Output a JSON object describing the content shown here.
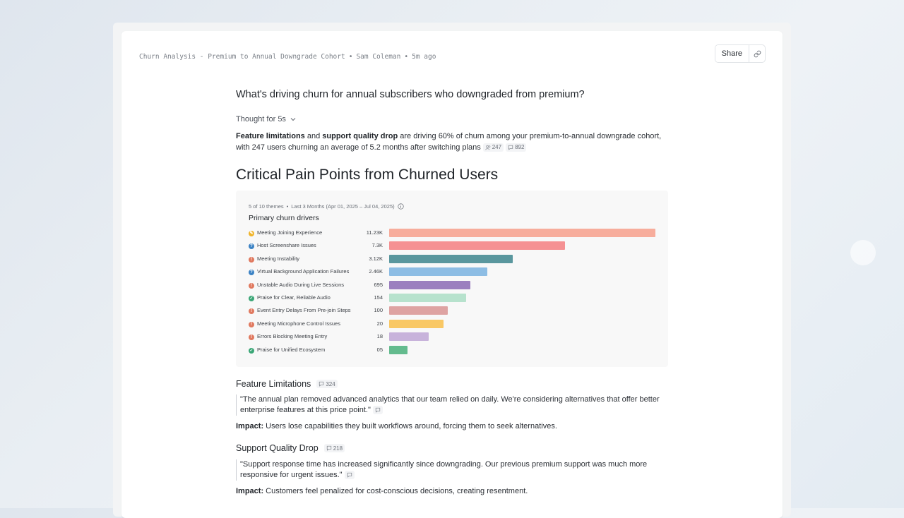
{
  "header": {
    "breadcrumb_title": "Churn Analysis - Premium to Annual Downgrade Cohort",
    "author": "Sam Coleman",
    "time": "5m ago",
    "share_label": "Share",
    "separator": "•"
  },
  "question": "What's driving churn for annual subscribers who downgraded from premium?",
  "thought_label": "Thought for 5s",
  "summary": {
    "b1": "Feature limitations",
    "t1": " and ",
    "b2": "support quality drop",
    "t2": " are driving 60% of churn among your premium-to-annual downgrade cohort, with 247 users churning an average of 5.2 months after switching plans",
    "users_count": "247",
    "comments_count": "892"
  },
  "section_title": "Critical Pain Points from Churned Users",
  "chart_data": {
    "type": "bar",
    "meta": "5 of 10 themes",
    "range": "Last 3 Months (Apr 01, 2025 – Jul 04, 2025)",
    "title": "Primary churn drivers",
    "categories": [
      "Meeting Joining Experience",
      "Host Screenshare Issues",
      "Meeting Instability",
      "Virtual Background Application Failures",
      "Unstable Audio During Live Sessions",
      "Praise for Clear, Reliable Audio",
      "Event Entry Delays From Pre-join Steps",
      "Meeting Microphone Control Issues",
      "Errors Blocking Meeting Entry",
      "Praise for Unified Ecosystem"
    ],
    "value_labels": [
      "11.23K",
      "7.3K",
      "3.12K",
      "2.46K",
      "695",
      "154",
      "100",
      "20",
      "18",
      "05"
    ],
    "relative_lengths": [
      1.0,
      0.66,
      0.465,
      0.368,
      0.305,
      0.288,
      0.22,
      0.205,
      0.148,
      0.068
    ],
    "status": [
      "warning",
      "question",
      "negative",
      "question",
      "negative",
      "positive",
      "negative",
      "negative",
      "negative",
      "positive"
    ],
    "colors": [
      "#f7ad9c",
      "#f59193",
      "#5a979e",
      "#8dbde4",
      "#9b7fbf",
      "#b7e2cd",
      "#dea3a2",
      "#f9c865",
      "#c8b3db",
      "#64bb8e"
    ],
    "status_colors": {
      "warning": "#f0b429",
      "question": "#3b82c4",
      "negative": "#e0785e",
      "positive": "#3aa676"
    }
  },
  "themes": [
    {
      "title": "Feature Limitations",
      "count": "324",
      "quote": "\"The annual plan removed advanced analytics that our team relied on daily. We're considering alternatives that offer better enterprise features at this price point.\"",
      "impact_label": "Impact:",
      "impact_text": " Users lose capabilities they built workflows around, forcing them to seek alternatives."
    },
    {
      "title": "Support Quality Drop",
      "count": "218",
      "quote": "\"Support response time has increased significantly since downgrading. Our previous premium support was much more responsive for urgent issues.\"",
      "impact_label": "Impact:",
      "impact_text": " Customers feel penalized for cost-conscious decisions, creating resentment."
    }
  ]
}
